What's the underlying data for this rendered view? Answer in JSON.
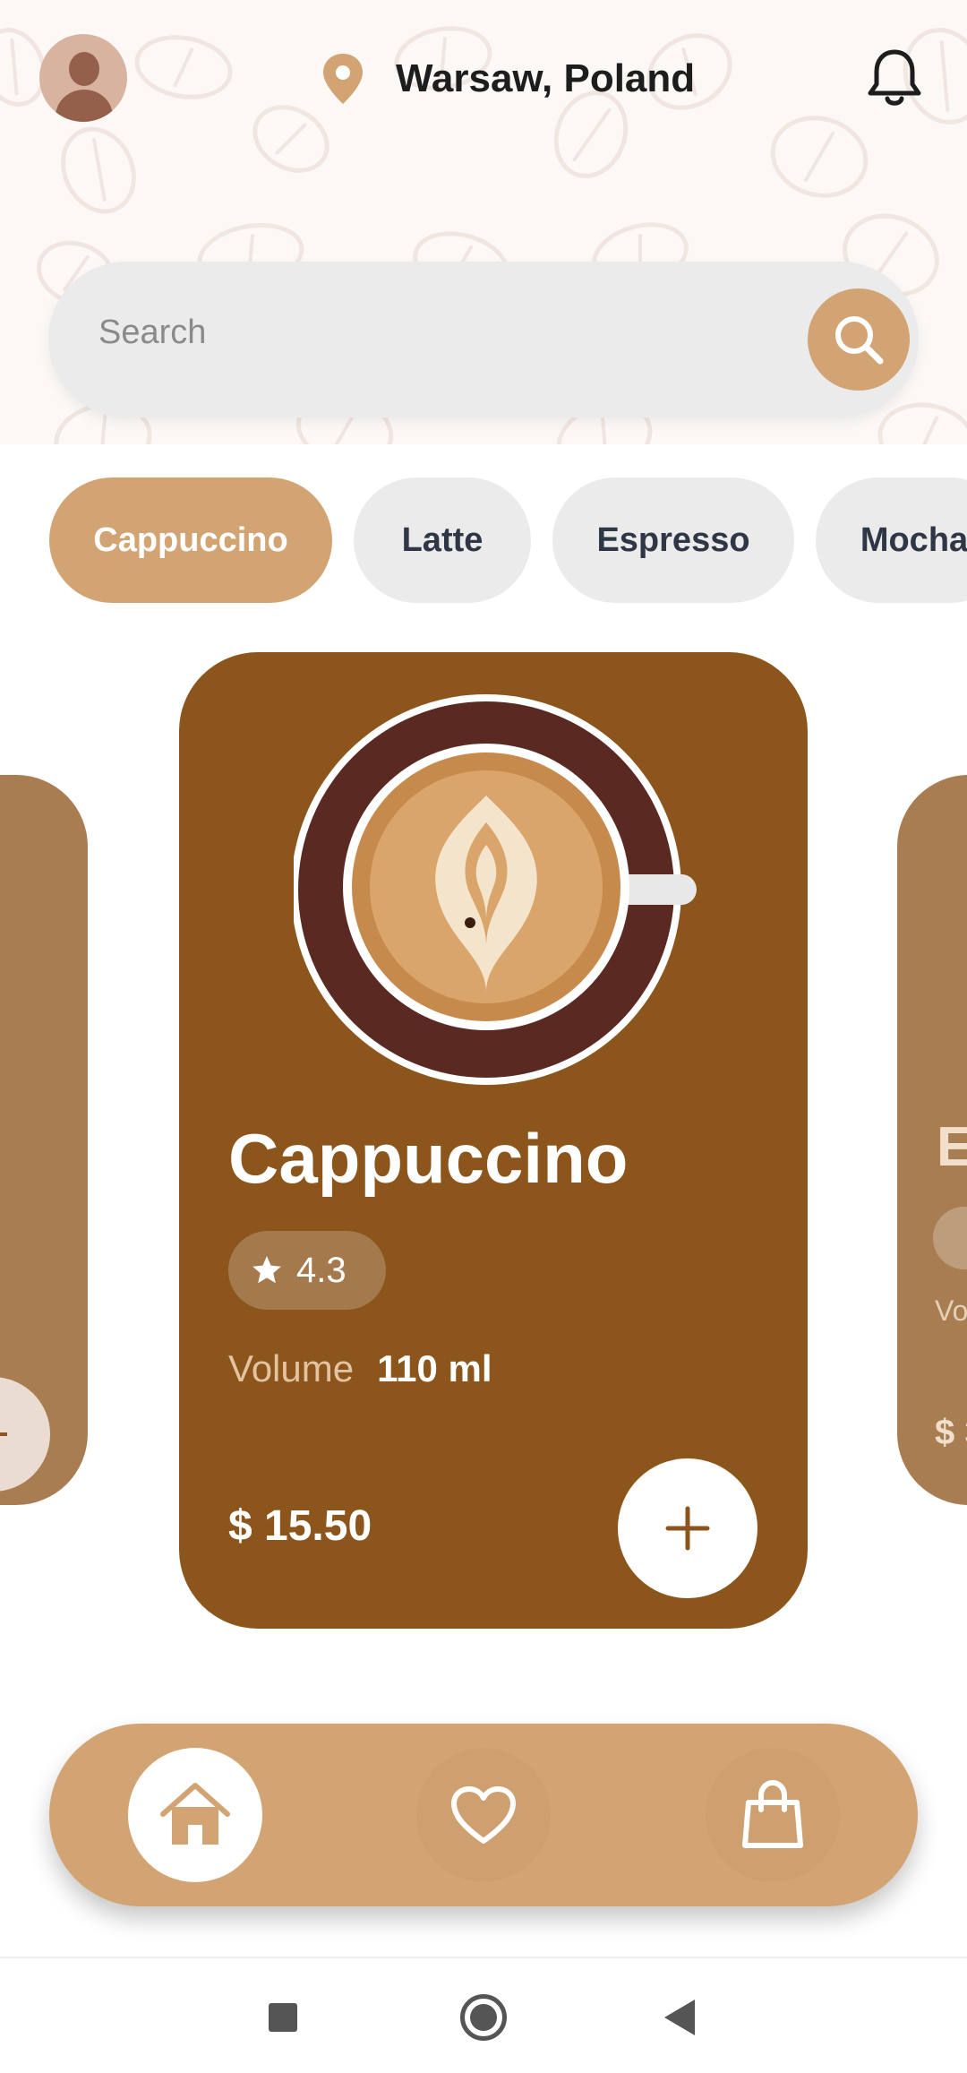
{
  "header": {
    "location": "Warsaw, Poland",
    "icons": [
      "avatar",
      "location-pin-icon",
      "bell-icon"
    ]
  },
  "search": {
    "placeholder": "Search",
    "icon": "search-icon"
  },
  "categories": [
    {
      "label": "Cappuccino",
      "active": true
    },
    {
      "label": "Latte",
      "active": false
    },
    {
      "label": "Espresso",
      "active": false
    },
    {
      "label": "Mocha",
      "active": false
    }
  ],
  "featured": {
    "name": "Cappuccino",
    "rating": "4.3",
    "volume_label": "Volume",
    "volume_value": "110 ml",
    "price": "$ 15.50"
  },
  "side_cards": {
    "right_title_partial": "E",
    "right_volume_partial": "Vo",
    "right_price_partial": "$ 3"
  },
  "nav": {
    "items": [
      "home-icon",
      "heart-icon",
      "shopping-bag-icon"
    ],
    "active": "home-icon"
  },
  "colors": {
    "accent": "#d3a473",
    "card": "#8b551b",
    "side_card": "#a87d52"
  }
}
